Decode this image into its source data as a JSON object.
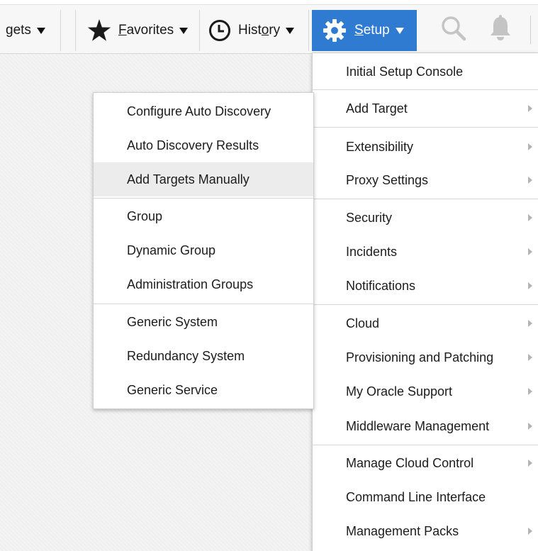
{
  "toolbar": {
    "targets_label": "gets",
    "favorites_prefix": "",
    "favorites_accel": "F",
    "favorites_rest": "avorites",
    "history_prefix": "Hist",
    "history_accel": "o",
    "history_rest": "ry",
    "setup_accel": "S",
    "setup_rest": "etup",
    "search_icon": "search-icon",
    "bell_icon": "bell-icon",
    "setup_color": "#2f7bd1"
  },
  "setup_menu": {
    "items": [
      {
        "label": "Initial Setup Console",
        "submenu": false
      },
      {
        "label": "Add Target",
        "submenu": true
      },
      {
        "label": "Extensibility",
        "submenu": true
      },
      {
        "label": "Proxy Settings",
        "submenu": true
      },
      {
        "label": "Security",
        "submenu": true
      },
      {
        "label": "Incidents",
        "submenu": true
      },
      {
        "label": "Notifications",
        "submenu": true
      },
      {
        "label": "Cloud",
        "submenu": true
      },
      {
        "label": "Provisioning and Patching",
        "submenu": true
      },
      {
        "label": "My Oracle Support",
        "submenu": true
      },
      {
        "label": "Middleware Management",
        "submenu": true
      },
      {
        "label": "Manage Cloud Control",
        "submenu": true
      },
      {
        "label": "Command Line Interface",
        "submenu": false
      },
      {
        "label": "Management Packs",
        "submenu": true
      }
    ]
  },
  "add_target_menu": {
    "items": [
      {
        "label": "Configure Auto Discovery"
      },
      {
        "label": "Auto Discovery Results"
      },
      {
        "label": "Add Targets Manually",
        "highlighted": true
      },
      {
        "label": "Group"
      },
      {
        "label": "Dynamic Group"
      },
      {
        "label": "Administration Groups"
      },
      {
        "label": "Generic System"
      },
      {
        "label": "Redundancy System"
      },
      {
        "label": "Generic Service"
      }
    ]
  }
}
